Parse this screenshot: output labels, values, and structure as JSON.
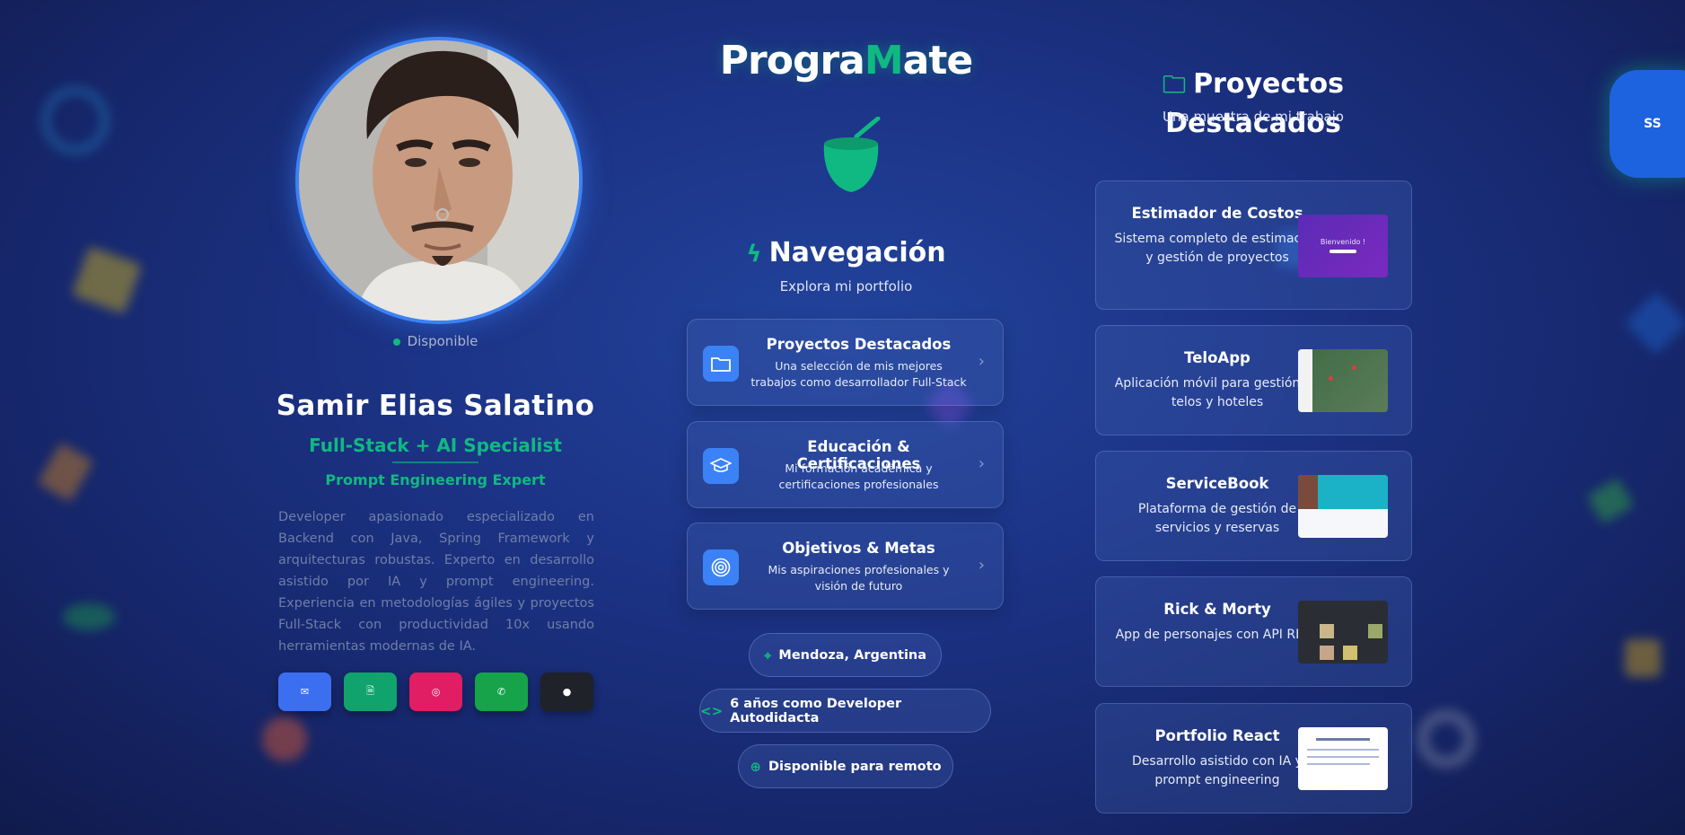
{
  "profile": {
    "status": "Disponible",
    "name": "Samir Elias Salatino",
    "role": "Full-Stack + AI Specialist",
    "sub_role": "Prompt Engineering Expert",
    "bio": "Developer apasionado especializado en Backend con Java, Spring Framework y arquitecturas robustas. Experto en desarrollo asistido por IA y prompt engineering. Experiencia en metodologías ágiles y proyectos Full-Stack con productividad 10x usando herramientas modernas de IA.",
    "socials": [
      {
        "icon": "mail-icon",
        "color": "#3b6ff0"
      },
      {
        "icon": "document-icon",
        "color": "#10a36d"
      },
      {
        "icon": "instagram-icon",
        "color": "#e11d63"
      },
      {
        "icon": "whatsapp-icon",
        "color": "#16a34a"
      },
      {
        "icon": "github-icon",
        "color": "#1f2229"
      }
    ]
  },
  "brand": {
    "logo_left": "Progra",
    "logo_mid": "M",
    "logo_right": "ate"
  },
  "navigation": {
    "title": "Navegación",
    "subtitle": "Explora mi portfolio",
    "cards": [
      {
        "title": "Proyectos Destacados",
        "desc": "Una selección de mis mejores trabajos como desarrollador Full-Stack",
        "icon": "folder-icon"
      },
      {
        "title": "Educación & Certificaciones",
        "desc": "Mi formación académica y certificaciones profesionales",
        "icon": "graduation-cap-icon"
      },
      {
        "title": "Objetivos & Metas",
        "desc": "Mis aspiraciones profesionales y visión de futuro",
        "icon": "target-icon"
      }
    ]
  },
  "pills": [
    {
      "label": "Mendoza, Argentina",
      "icon": "location-pin-icon"
    },
    {
      "label": "6 años como Developer Autodidacta",
      "icon": "code-icon"
    },
    {
      "label": "Disponible para remoto",
      "icon": "globe-icon"
    }
  ],
  "projects": {
    "title": "Proyectos Destacados",
    "subtitle": "Una muestra de mi trabajo",
    "items": [
      {
        "title": "Estimador de Costos",
        "desc": "Sistema completo de estimación y gestión de proyectos",
        "thumb_text": "Bienvenido !"
      },
      {
        "title": "TeloApp",
        "desc": "Aplicación móvil para gestión de telos y hoteles"
      },
      {
        "title": "ServiceBook",
        "desc": "Plataforma de gestión de servicios y reservas"
      },
      {
        "title": "Rick & Morty",
        "desc": "App de personajes con API REST"
      },
      {
        "title": "Portfolio React",
        "desc": "Desarrollo asistido con IA y prompt engineering"
      }
    ]
  },
  "user_badge": "SS",
  "colors": {
    "accent": "#10b981",
    "primary": "#3b82f6",
    "background": "#1c3487"
  }
}
